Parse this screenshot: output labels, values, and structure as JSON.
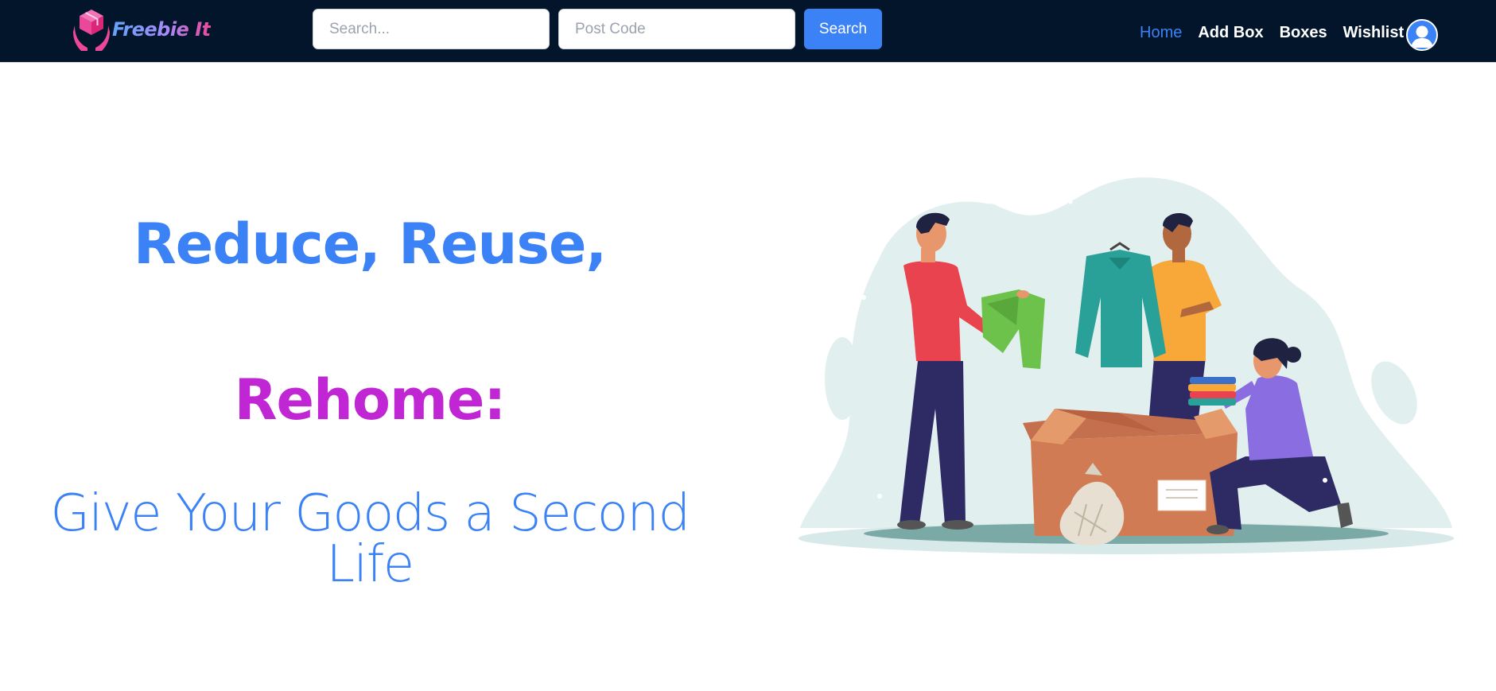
{
  "brand": {
    "name": "Freebie It",
    "logo_icon": "box-in-hands-icon"
  },
  "search": {
    "query_placeholder": "Search...",
    "query_value": "",
    "postcode_placeholder": "Post Code",
    "postcode_value": "",
    "button_label": "Search"
  },
  "nav": {
    "items": [
      {
        "label": "Home",
        "active": true
      },
      {
        "label": "Add Box",
        "active": false
      },
      {
        "label": "Boxes",
        "active": false
      },
      {
        "label": "Wishlist",
        "active": false
      }
    ],
    "avatar_icon": "user-avatar-icon"
  },
  "hero": {
    "line1": "Reduce, Reuse,",
    "line2": "Rehome:",
    "subtitle": "Give Your Goods a Second Life",
    "illustration": "people-sharing-clothes-illustration"
  },
  "colors": {
    "navbar_bg": "#03152b",
    "accent_blue": "#3b82f6",
    "accent_magenta": "#c026d3",
    "logo_pink": "#ec4899"
  }
}
